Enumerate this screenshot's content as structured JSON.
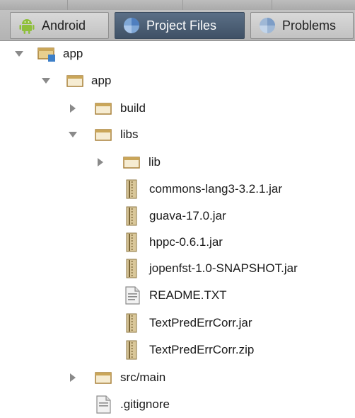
{
  "tabs": [
    {
      "label": "Android",
      "icon": "android-icon",
      "active": false
    },
    {
      "label": "Project Files",
      "icon": "project-files-icon",
      "active": true
    },
    {
      "label": "Problems",
      "icon": "problems-icon",
      "active": false
    }
  ],
  "tree": {
    "rows": [
      {
        "label": "app",
        "type": "module",
        "expanded": true
      },
      {
        "label": "app",
        "type": "folder",
        "expanded": true
      },
      {
        "label": "build",
        "type": "folder",
        "expanded": false
      },
      {
        "label": "libs",
        "type": "folder",
        "expanded": true
      },
      {
        "label": "lib",
        "type": "folder",
        "expanded": false
      },
      {
        "label": "commons-lang3-3.2.1.jar",
        "type": "archive"
      },
      {
        "label": "guava-17.0.jar",
        "type": "archive"
      },
      {
        "label": "hppc-0.6.1.jar",
        "type": "archive"
      },
      {
        "label": "jopenfst-1.0-SNAPSHOT.jar",
        "type": "archive"
      },
      {
        "label": "README.TXT",
        "type": "text"
      },
      {
        "label": "TextPredErrCorr.jar",
        "type": "archive"
      },
      {
        "label": "TextPredErrCorr.zip",
        "type": "archive"
      },
      {
        "label": "src/main",
        "type": "folder",
        "expanded": false
      },
      {
        "label": ".gitignore",
        "type": "text"
      }
    ]
  }
}
